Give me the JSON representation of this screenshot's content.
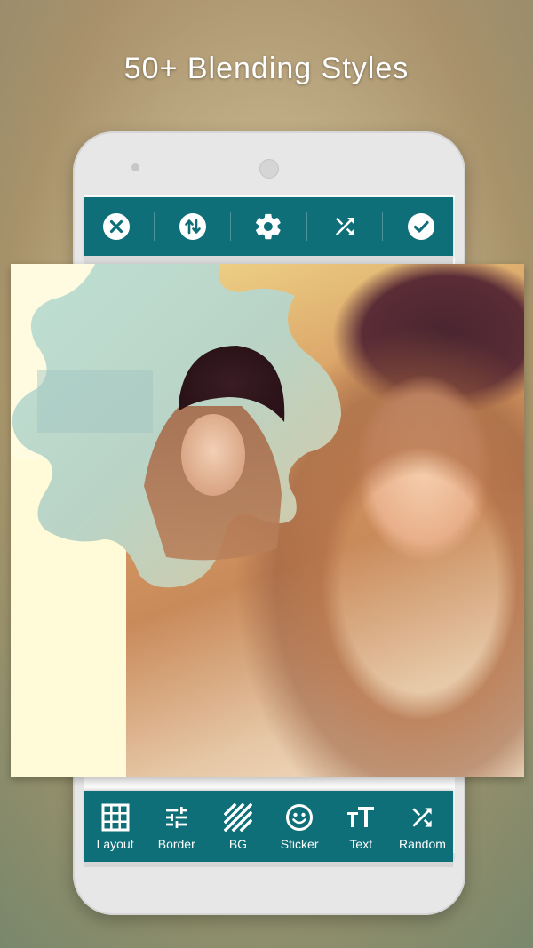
{
  "headline": "50+ Blending Styles",
  "colors": {
    "toolbar": "#0f6f78",
    "icon": "#ffffff",
    "canvas_bg": "#fffbe1"
  },
  "top_toolbar": {
    "buttons": [
      {
        "icon": "close-icon"
      },
      {
        "icon": "swap-icon"
      },
      {
        "icon": "settings-icon"
      },
      {
        "icon": "shuffle-icon"
      },
      {
        "icon": "check-icon"
      }
    ]
  },
  "bottom_toolbar": {
    "items": [
      {
        "label": "Layout",
        "icon": "grid-icon"
      },
      {
        "label": "Border",
        "icon": "sliders-icon"
      },
      {
        "label": "BG",
        "icon": "stripes-icon"
      },
      {
        "label": "Sticker",
        "icon": "smiley-icon"
      },
      {
        "label": "Text",
        "icon": "text-icon"
      },
      {
        "label": "Random",
        "icon": "shuffle-icon"
      }
    ]
  }
}
